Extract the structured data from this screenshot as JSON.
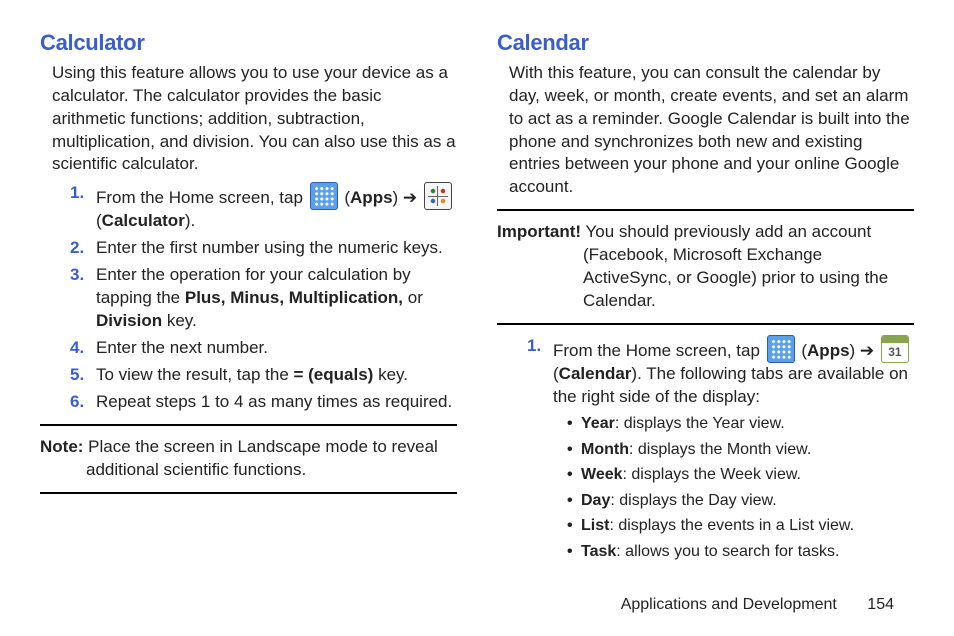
{
  "left": {
    "heading": "Calculator",
    "intro": "Using this feature allows you to use your device as a calculator. The calculator provides the basic arithmetic functions; addition, subtraction, multiplication, and division. You can also use this as a scientific calculator.",
    "steps": {
      "s1_pre": "From the Home screen, tap ",
      "s1_apps": "Apps",
      "s1_arrow": " ➔ ",
      "s1_calc": "Calculator",
      "s2": "Enter the first number using the numeric keys.",
      "s3_pre": "Enter the operation for your calculation by tapping the ",
      "s3_keys": "Plus, Minus, Multiplication,",
      "s3_or": " or ",
      "s3_div": "Division",
      "s3_post": " key.",
      "s4": "Enter the next number.",
      "s5_pre": "To view the result, tap the ",
      "s5_eq": "=  (equals)",
      "s5_post": " key.",
      "s6": "Repeat steps 1 to 4 as many times as required."
    },
    "note_label": "Note:",
    "note_text": " Place the screen in Landscape mode to reveal additional scientific functions."
  },
  "right": {
    "heading": "Calendar",
    "intro": "With this feature, you can consult the calendar by day, week, or month, create events, and set an alarm to act as a reminder. Google Calendar is built into the phone and synchronizes both new and existing entries between your phone and your online Google account.",
    "imp_label": "Important!",
    "imp_text": " You should previously add an account (Facebook, Microsoft Exchange ActiveSync, or Google) prior to using the Calendar.",
    "steps": {
      "s1_pre": "From the Home screen, tap ",
      "s1_apps": "Apps",
      "s1_arrow": " ➔ ",
      "s1_cal": "Calendar",
      "s1_post": ". The following tabs are available on the right side of the display:"
    },
    "bullets": {
      "year_b": "Year",
      "year_t": ": displays the Year view.",
      "month_b": "Month",
      "month_t": ": displays the Month view.",
      "week_b": "Week",
      "week_t": ": displays the Week view.",
      "day_b": "Day",
      "day_t": ": displays the Day view.",
      "list_b": "List",
      "list_t": ": displays the events in a List view.",
      "task_b": "Task",
      "task_t": ": allows you to search for tasks."
    },
    "cal_day": "31"
  },
  "footer": {
    "section": "Applications and Development",
    "page": "154"
  }
}
